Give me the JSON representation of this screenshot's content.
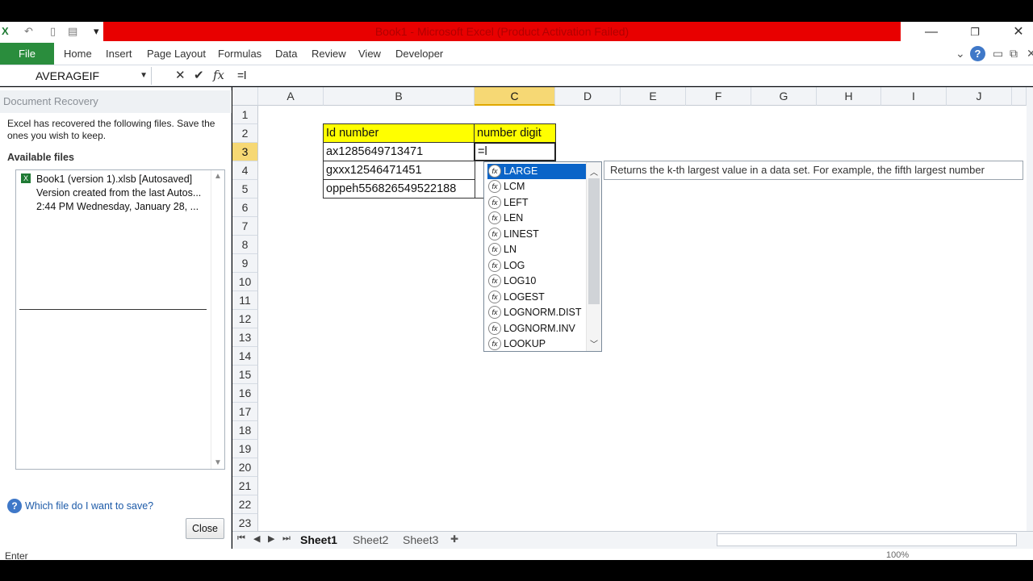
{
  "window": {
    "title": "Book1 - Microsoft Excel (Product Activation Failed)",
    "minimize": "—",
    "restore": "❐",
    "close": "✕"
  },
  "ribbon": {
    "file": "File",
    "tabs": [
      "Home",
      "Insert",
      "Page Layout",
      "Formulas",
      "Data",
      "Review",
      "View",
      "Developer"
    ],
    "help": "?"
  },
  "formula_bar": {
    "name_box": "AVERAGEIF",
    "formula": "=l"
  },
  "recovery": {
    "title": "Document Recovery",
    "intro": "Excel has recovered the following files.  Save the ones you wish to keep.",
    "available": "Available files",
    "file": {
      "name": "Book1 (version 1).xlsb  [Autosaved]",
      "desc": "Version created from the last Autos...",
      "time": "2:44 PM Wednesday, January 28, ..."
    },
    "help_link": "Which file do I want to save?",
    "close": "Close"
  },
  "columns": [
    "A",
    "B",
    "C",
    "D",
    "E",
    "F",
    "G",
    "H",
    "I",
    "J"
  ],
  "rows": [
    "1",
    "2",
    "3",
    "4",
    "5",
    "6",
    "7",
    "8",
    "9",
    "10",
    "11",
    "12",
    "13",
    "14",
    "15",
    "16",
    "17",
    "18",
    "19",
    "20",
    "21",
    "22",
    "23"
  ],
  "cells": {
    "B2": "Id number",
    "C2": "number digit",
    "B3": "ax1285649713471",
    "C3": "=l",
    "B4": "gxxx12546471451",
    "B5": "oppeh556826549522188"
  },
  "autocomplete": {
    "items": [
      "LARGE",
      "LCM",
      "LEFT",
      "LEN",
      "LINEST",
      "LN",
      "LOG",
      "LOG10",
      "LOGEST",
      "LOGNORM.DIST",
      "LOGNORM.INV",
      "LOOKUP"
    ],
    "selected": "LARGE",
    "fx_glyph": "fx",
    "tooltip": "Returns the k-th largest value in a data set. For example, the fifth largest number"
  },
  "sheets": [
    "Sheet1",
    "Sheet2",
    "Sheet3"
  ],
  "active_sheet": "Sheet1",
  "status": {
    "mode": "Enter",
    "zoom": "100%"
  },
  "colors": {
    "title_red": "#e80000",
    "file_green": "#2a8d3d",
    "header_yellow": "#ffff00",
    "selected_blue": "#0a64c8"
  }
}
